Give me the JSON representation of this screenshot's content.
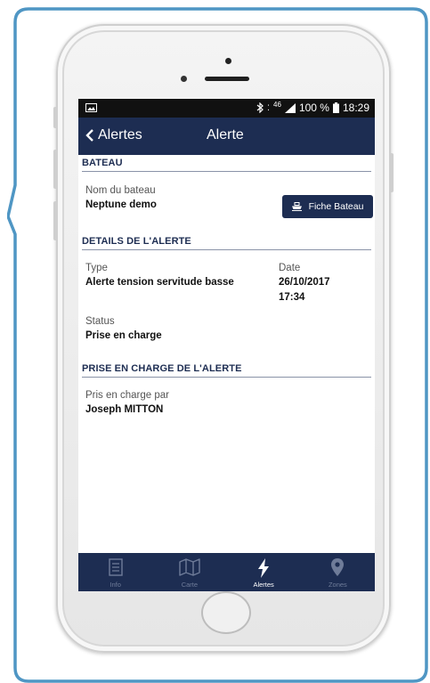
{
  "status_bar": {
    "network": "46",
    "battery": "100 %",
    "time": "18:29"
  },
  "nav": {
    "back_label": "Alertes",
    "title": "Alerte"
  },
  "bateau": {
    "section_title": "BATEAU",
    "name_label": "Nom du bateau",
    "name_value": "Neptune demo",
    "fiche_button": "Fiche Bateau"
  },
  "details": {
    "section_title": "DETAILS DE L'ALERTE",
    "type_label": "Type",
    "type_value": "Alerte tension servitude basse",
    "date_label": "Date",
    "date_value": "26/10/2017",
    "time_value": "17:34",
    "status_label": "Status",
    "status_value": "Prise en charge"
  },
  "prise": {
    "section_title": "PRISE EN CHARGE DE L'ALERTE",
    "by_label": "Pris en charge par",
    "by_value": "Joseph MITTON"
  },
  "tabs": [
    {
      "label": "Info",
      "icon": "info-icon",
      "active": false
    },
    {
      "label": "Carte",
      "icon": "map-icon",
      "active": false
    },
    {
      "label": "Alertes",
      "icon": "lightning-icon",
      "active": true
    },
    {
      "label": "Zones",
      "icon": "location-pin-icon",
      "active": false
    }
  ],
  "colors": {
    "nav_blue": "#1d2d52",
    "frame_blue": "#4f96c4"
  }
}
